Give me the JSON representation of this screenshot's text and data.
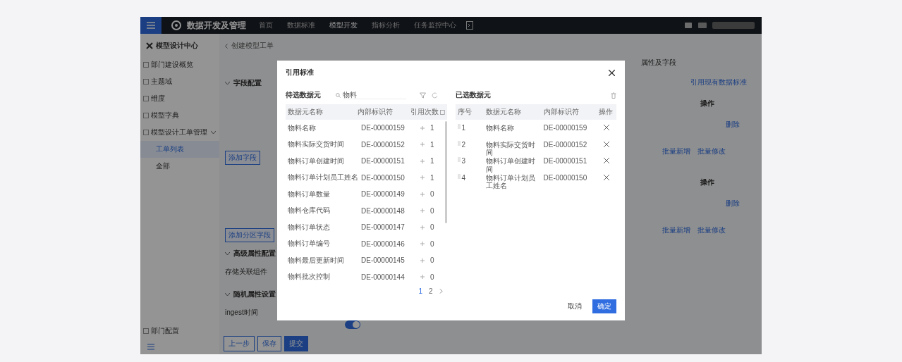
{
  "app": {
    "logo": "数据开发及管理",
    "nav": [
      {
        "label": "首页",
        "selected": false
      },
      {
        "label": "数据标准",
        "selected": false
      },
      {
        "label": "模型开发",
        "selected": true
      },
      {
        "label": "指标分析",
        "selected": false
      },
      {
        "label": "任务监控中心",
        "selected": false
      }
    ]
  },
  "sidebar": {
    "title": "模型设计中心",
    "items": [
      {
        "label": "部门建设概览",
        "selected": false
      },
      {
        "label": "主题域",
        "selected": false
      },
      {
        "label": "维度",
        "selected": false
      },
      {
        "label": "模型字典",
        "selected": false
      },
      {
        "label": "模型设计工单管理",
        "selected": false,
        "expanded": true,
        "children": [
          {
            "label": "工单列表",
            "selected": true
          },
          {
            "label": "全部",
            "selected": false
          }
        ]
      }
    ],
    "footer": "部门配置"
  },
  "breadcrumb": "创建模型工单",
  "form": {
    "left": [
      {
        "kind": "section",
        "label": "字段配置"
      },
      {
        "kind": "button",
        "label": "添加字段"
      },
      {
        "kind": "button",
        "label": "添加分区字段"
      },
      {
        "kind": "section",
        "label": "高级属性配置"
      },
      {
        "kind": "field",
        "label": "存储关联组件"
      },
      {
        "kind": "section",
        "label": "随机属性设置"
      },
      {
        "kind": "field",
        "label": "ingest时间"
      }
    ],
    "toggle": {
      "on": true
    },
    "right": [
      {
        "kind": "text",
        "label": "属性及字段"
      },
      {
        "kind": "link",
        "label": "引用现有数据标准"
      },
      {
        "kind": "header",
        "label": "操作"
      },
      {
        "kind": "link",
        "label": "删除"
      },
      {
        "kind": "links",
        "label": "批量新增",
        "label2": "批量修改"
      },
      {
        "kind": "header",
        "label": "操作"
      },
      {
        "kind": "link",
        "label": "删除"
      },
      {
        "kind": "links",
        "label": "批量新增",
        "label2": "批量修改"
      }
    ],
    "buttons": [
      {
        "label": "上一步",
        "primary": false
      },
      {
        "label": "保存",
        "primary": false
      },
      {
        "label": "提交",
        "primary": true
      }
    ]
  },
  "dialog": {
    "title": "引用标准",
    "available": {
      "title": "待选数据元",
      "search": "物料",
      "columns": [
        "数据元名称",
        "内部标识符",
        "引用次数"
      ],
      "rows": [
        {
          "name": "物料名称",
          "id": "DE-00000159",
          "count": "1"
        },
        {
          "name": "物料实际交货时间",
          "id": "DE-00000152",
          "count": "1"
        },
        {
          "name": "物料订单创建时间",
          "id": "DE-00000151",
          "count": "1"
        },
        {
          "name": "物料订单计划员工姓名",
          "id": "DE-00000150",
          "count": "1"
        },
        {
          "name": "物料订单数量",
          "id": "DE-00000149",
          "count": "0"
        },
        {
          "name": "物料仓库代码",
          "id": "DE-00000148",
          "count": "0"
        },
        {
          "name": "物料订单状态",
          "id": "DE-00000147",
          "count": "0"
        },
        {
          "name": "物料订单编号",
          "id": "DE-00000146",
          "count": "0"
        },
        {
          "name": "物料最后更新时间",
          "id": "DE-00000145",
          "count": "0"
        },
        {
          "name": "物料批次控制",
          "id": "DE-00000144",
          "count": "0"
        }
      ],
      "pages": [
        {
          "label": "1",
          "selected": true
        },
        {
          "label": "2",
          "selected": false
        }
      ]
    },
    "chosen": {
      "title": "已选数据元",
      "columns": [
        "序号",
        "数据元名称",
        "内部标识符",
        "操作"
      ],
      "rows": [
        {
          "no": "1",
          "name": "物料名称",
          "id": "DE-00000159"
        },
        {
          "no": "2",
          "name": "物料实际交货时间",
          "id": "DE-00000152"
        },
        {
          "no": "3",
          "name": "物料订单创建时间",
          "id": "DE-00000151"
        },
        {
          "no": "4",
          "name": "物料订单计划员工姓名",
          "id": "DE-00000150"
        }
      ]
    },
    "buttons": [
      {
        "label": "取消",
        "primary": false
      },
      {
        "label": "确定",
        "primary": true
      }
    ]
  }
}
